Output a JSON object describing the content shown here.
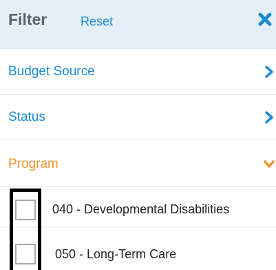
{
  "header": {
    "title": "Filter",
    "reset_label": "Reset",
    "close_icon": "close-icon"
  },
  "sections": [
    {
      "label": "Budget Source",
      "expanded": false,
      "icon": "chevron-right-icon"
    },
    {
      "label": "Status",
      "expanded": false,
      "icon": "chevron-right-icon"
    },
    {
      "label": "Program",
      "expanded": true,
      "icon": "chevron-down-icon"
    }
  ],
  "program_options": [
    {
      "label": "040 - Developmental Disabilities",
      "checked": false
    },
    {
      "label": "050 - Long-Term Care",
      "checked": false
    }
  ],
  "colors": {
    "header_bg": "#e4eff8",
    "link_blue": "#1a8ad4",
    "active_orange": "#f0922b",
    "title_gray": "#5b6268",
    "highlight_border": "#000000"
  }
}
